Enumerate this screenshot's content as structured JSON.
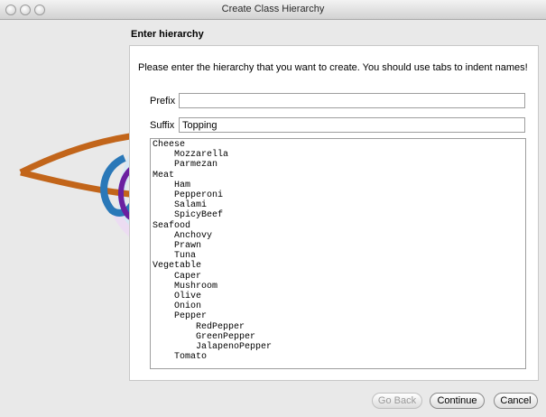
{
  "window": {
    "title": "Create Class Hierarchy"
  },
  "wizard": {
    "section_title": "Enter hierarchy",
    "instructions": "Please enter the hierarchy that you want to create.  You should use tabs to indent names!",
    "prefix": {
      "label": "Prefix",
      "value": ""
    },
    "suffix": {
      "label": "Suffix",
      "value": "Topping"
    },
    "hierarchy_text": "Cheese\n    Mozzarella\n    Parmezan\nMeat\n    Ham\n    Pepperoni\n    Salami\n    SpicyBeef\nSeafood\n    Anchovy\n    Prawn\n    Tuna\nVegetable\n    Caper\n    Mushroom\n    Olive\n    Onion\n    Pepper\n        RedPepper\n        GreenPepper\n        JalapenoPepper\n    Tomato"
  },
  "buttons": {
    "back": "Go Back",
    "continue": "Continue",
    "cancel": "Cancel"
  },
  "colors": {
    "logo_orange": "#c2651a",
    "logo_blue": "#2a78b8",
    "logo_purple": "#6b1fa0",
    "logo_light_blue": "#cfe3f2",
    "logo_light_purple": "#e8d7ef"
  },
  "icons": {
    "close": "close-icon",
    "minimize": "minimize-icon",
    "zoom": "zoom-icon",
    "logo": "protege-logo"
  }
}
